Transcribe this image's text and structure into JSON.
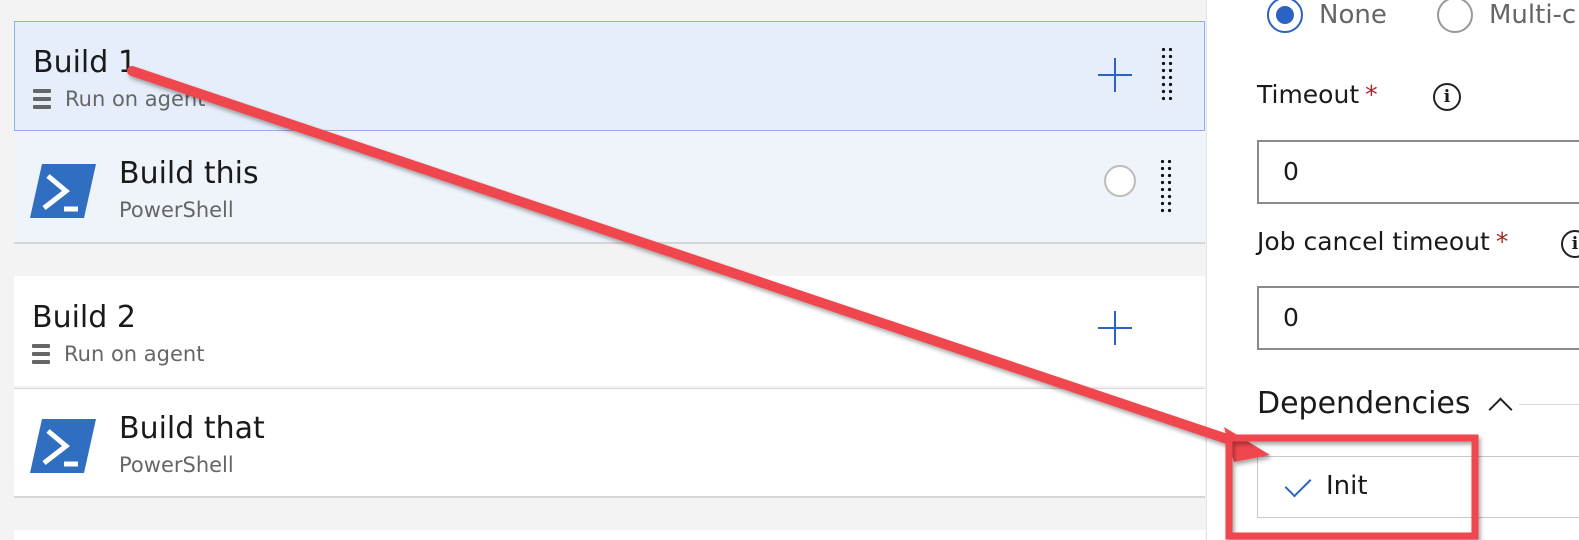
{
  "phases": [
    {
      "title": "Build 1",
      "subtitle": "Run on agent",
      "task": {
        "title": "Build this",
        "subtitle": "PowerShell"
      }
    },
    {
      "title": "Build 2",
      "subtitle": "Run on agent",
      "task": {
        "title": "Build that",
        "subtitle": "PowerShell"
      }
    }
  ],
  "panel": {
    "radio_options": [
      "None",
      "Multi-c"
    ],
    "radio_selected": "None",
    "timeout_label": "Timeout",
    "timeout_value": "0",
    "cancel_label": "Job cancel timeout",
    "cancel_value": "0",
    "required_mark": "*",
    "info_glyph": "i",
    "dependencies_label": "Dependencies",
    "dependency_item": "Init"
  },
  "icons": {
    "add": "plus-icon",
    "drag": "drag-handle-icon",
    "agent": "server-icon",
    "task": "powershell-icon",
    "info": "info-icon",
    "collapse": "chevron-up-icon",
    "check": "check-icon"
  },
  "colors": {
    "accent": "#2a63c4",
    "annotation": "#f0474f",
    "selected_row": "#e5eefa",
    "required": "#a4262c"
  }
}
